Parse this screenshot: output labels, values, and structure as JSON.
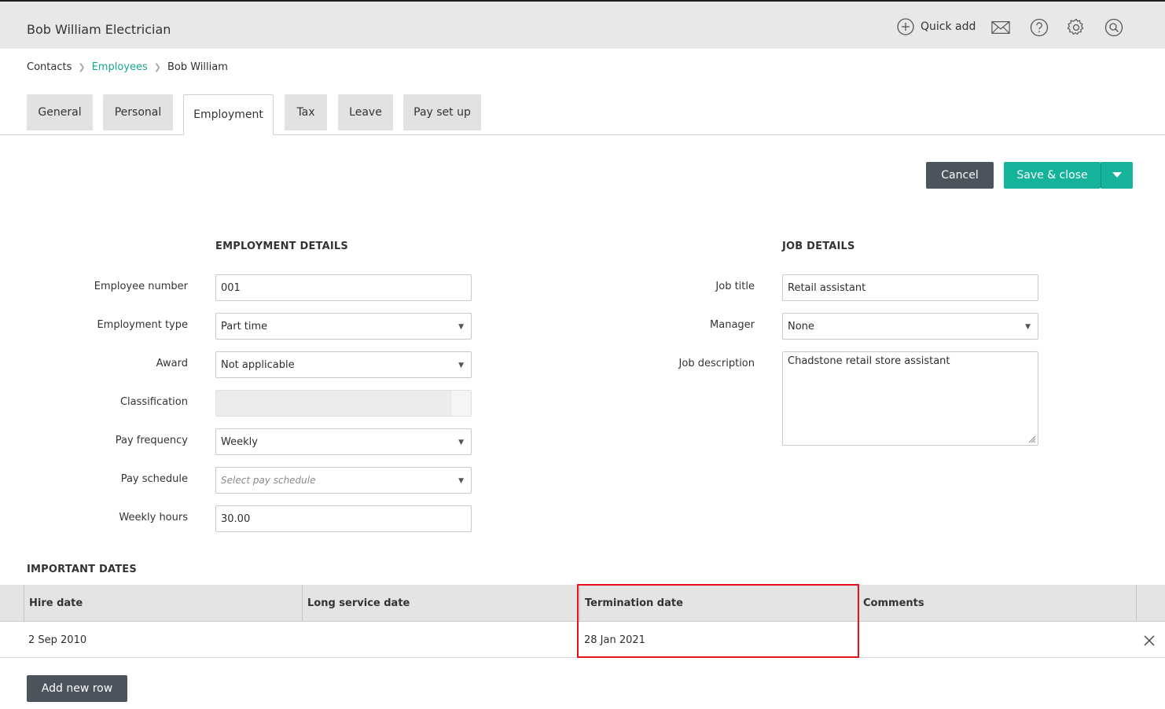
{
  "header": {
    "title": "Bob William Electrician",
    "quick_add": "Quick add",
    "icons": [
      "plus-circle-icon",
      "mail-icon",
      "help-icon",
      "gear-icon",
      "search-icon"
    ]
  },
  "breadcrumb": {
    "root": "Contacts",
    "section": "Employees",
    "current": "Bob William"
  },
  "tabs": {
    "general": "General",
    "personal": "Personal",
    "employment": "Employment",
    "tax": "Tax",
    "leave": "Leave",
    "pay_setup": "Pay set up",
    "active": "Employment"
  },
  "actions": {
    "cancel": "Cancel",
    "save": "Save & close"
  },
  "employment": {
    "heading": "EMPLOYMENT DETAILS",
    "employee_number_label": "Employee number",
    "employee_number": "001",
    "employment_type_label": "Employment type",
    "employment_type": "Part time",
    "award_label": "Award",
    "award": "Not applicable",
    "classification_label": "Classification",
    "classification": "",
    "pay_frequency_label": "Pay frequency",
    "pay_frequency": "Weekly",
    "pay_schedule_label": "Pay schedule",
    "pay_schedule_placeholder": "Select pay schedule",
    "weekly_hours_label": "Weekly hours",
    "weekly_hours": "30.00"
  },
  "job": {
    "heading": "JOB DETAILS",
    "job_title_label": "Job title",
    "job_title": "Retail assistant",
    "manager_label": "Manager",
    "manager": "None",
    "job_description_label": "Job description",
    "job_description": "Chadstone retail store assistant"
  },
  "important_dates": {
    "heading": "IMPORTANT DATES",
    "columns": [
      "Hire date",
      "Long service date",
      "Termination date",
      "Comments"
    ],
    "rows": [
      {
        "hire_date": "2 Sep 2010",
        "long_service_date": "",
        "termination_date": "28 Jan 2021",
        "comments": ""
      }
    ],
    "add_row": "Add new row"
  },
  "colors": {
    "accent": "#14b39a",
    "link": "#16a693",
    "dark_button": "#4b545c",
    "highlight": "#e5121e"
  }
}
